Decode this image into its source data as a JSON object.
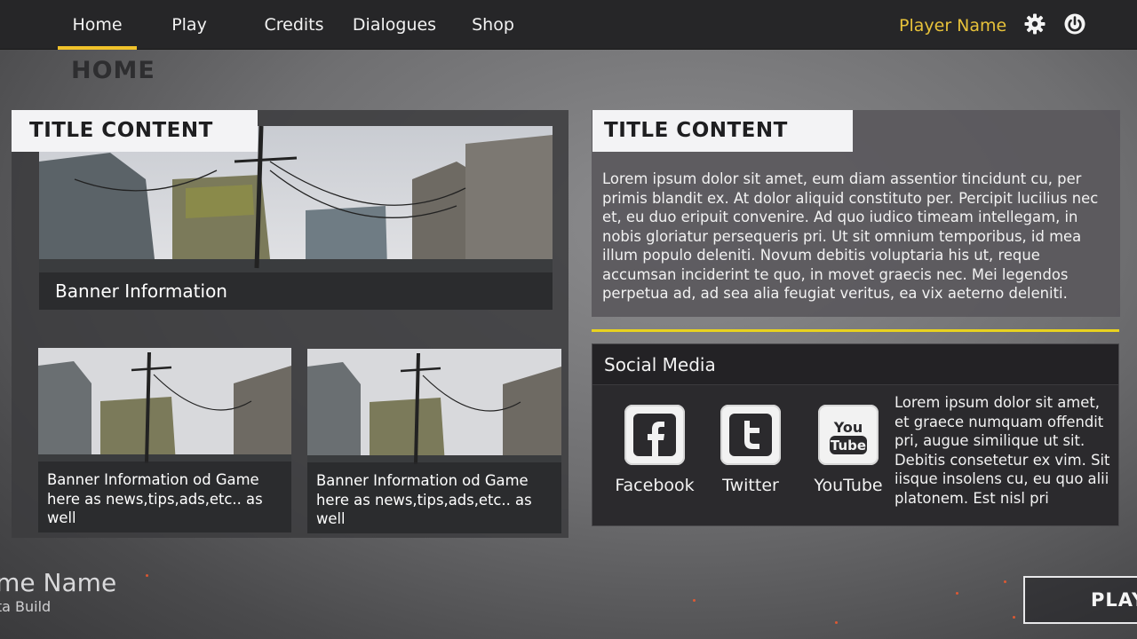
{
  "nav": {
    "items": [
      {
        "label": "Home",
        "active": true
      },
      {
        "label": "Play",
        "active": false
      },
      {
        "label": "Credits",
        "active": false
      },
      {
        "label": "Dialogues",
        "active": false
      },
      {
        "label": "Shop",
        "active": false
      }
    ],
    "player_name": "Player Name",
    "settings_icon": "gear-icon",
    "power_icon": "power-icon"
  },
  "page": {
    "heading": "HOME"
  },
  "left_panel": {
    "title": "TITLE CONTENT",
    "banner_caption": "Banner Information",
    "cards": [
      {
        "caption": "Banner Information od Game here as news,tips,ads,etc.. as well"
      },
      {
        "caption": "Banner Information od Game here as news,tips,ads,etc.. as well"
      }
    ]
  },
  "right_panel": {
    "title": "TITLE CONTENT",
    "body": "Lorem ipsum dolor sit amet, eum diam assentior tincidunt cu, per primis blandit ex. At dolor aliquid constituto per. Percipit lucilius nec et, eu duo eripuit convenire. Ad quo iudico timeam intellegam, in nobis gloriatur persequeris pri. Ut sit omnium temporibus, id mea illum populo deleniti. Novum debitis voluptaria his ut, reque accumsan inciderint te quo, in movet graecis nec. Mei legendos perpetua ad, ad sea alia feugiat veritus, ea vix aeterno deleniti."
  },
  "social": {
    "title": "Social Media",
    "links": [
      {
        "label": "Facebook",
        "icon": "facebook-icon"
      },
      {
        "label": "Twitter",
        "icon": "twitter-icon"
      },
      {
        "label": "YouTube",
        "icon": "youtube-icon"
      }
    ],
    "body": "Lorem ipsum dolor sit amet, et graece numquam offendit pri, augue similique ut sit. Debitis consetetur ex vim. Sit iisque insolens cu, eu quo alii platonem. Est nisl pri"
  },
  "footer": {
    "game_name": "ame Name",
    "build": "eta Build",
    "play_label": "PLAY"
  },
  "colors": {
    "accent": "#f0c22a",
    "player_name": "#e7c23a",
    "divider": "#e8d21f"
  }
}
